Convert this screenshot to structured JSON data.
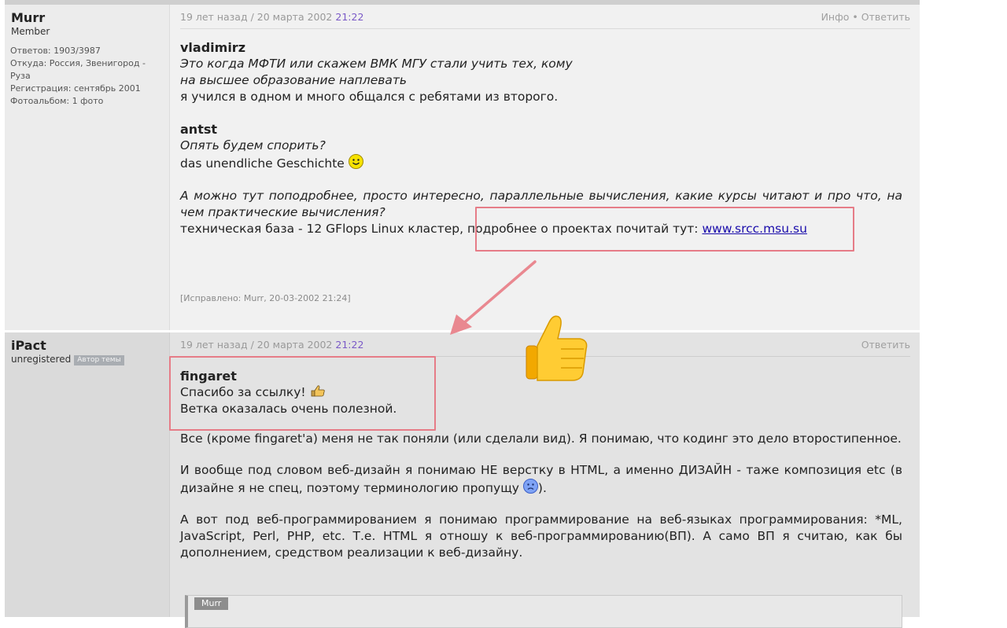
{
  "post1": {
    "username": "Murr",
    "role": "Member",
    "meta": [
      "Ответов: 1903/3987",
      "Откуда: Россия, Звенигород - Руза",
      "Регистрация: сентябрь 2001",
      "Фотоальбом: 1 фото"
    ],
    "date_prefix": "19 лет назад / 20 марта 2002",
    "time": "21:22",
    "info_link": "Инфо",
    "separator": "•",
    "reply_link": "Ответить",
    "quote1_author": "vladimirz",
    "quote1_lines": [
      "Это когда МФТИ или скажем ВМК МГУ стали учить тех, кому",
      "на высшее образование наплевать"
    ],
    "answer1": "я учился в одном и много общался с ребятами из второго.",
    "quote2_author": "antst",
    "quote2_line": "Опять будем спорить?",
    "answer2": "das unendliche Geschichte",
    "quote3": "А можно тут поподробнее, просто интересно, параллельные вычисления, какие курсы читают и про что, на чем практические вычисления?",
    "answer3_pre": "техническая база - 12 GFlops Linux кластер, подробнее о проектах почитай тут:",
    "answer3_link": "www.srcc.msu.su",
    "edited": "[Исправлено: Murr, 20-03-2002 21:24]"
  },
  "post2": {
    "username": "iPact",
    "role": "unregistered",
    "badge": "Автор темы",
    "date_prefix": "19 лет назад / 20 марта 2002",
    "time": "21:22",
    "reply_link": "Ответить",
    "quote_author": "fingaret",
    "quote_line1": "Спасибо за ссылку!",
    "quote_line2": "Ветка оказалась очень полезной.",
    "para1": "Все (кроме fingaret'а) меня не так поняли (или сделали вид). Я понимаю, что кодинг это дело второстипенное.",
    "para2_pre": "И вообще под словом веб-дизайн я понимаю НЕ верстку в HTML, а именно ДИЗАЙН - таже композиция etc (в дизайне я не спец, поэтому терминологию пропущу",
    "para2_post": ").",
    "para3": "А вот под веб-программированием я понимаю программирование на веб-языках программирования: *ML, JavaScript, Perl, PHP, etc. Т.е. HTML я отношу к веб-программированию(ВП). А само ВП я считаю, как бы дополнением, средством реализации к веб-дизайну.",
    "quote_tag": "Murr"
  },
  "annotations": {
    "highlight_color": "#e67c87",
    "emoji": "thumbs-up"
  }
}
